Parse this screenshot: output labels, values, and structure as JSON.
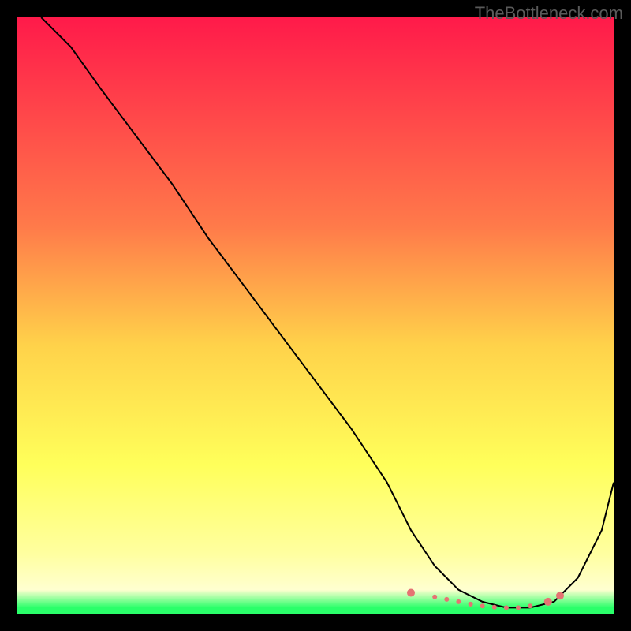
{
  "watermark": "TheBottleneck.com",
  "chart_data": {
    "type": "line",
    "title": "",
    "xlabel": "",
    "ylabel": "",
    "xlim": [
      0,
      100
    ],
    "ylim": [
      0,
      100
    ],
    "gradient_stops": [
      {
        "offset": 0,
        "color": "#ff1a4a"
      },
      {
        "offset": 35,
        "color": "#ff7a4a"
      },
      {
        "offset": 55,
        "color": "#ffd24a"
      },
      {
        "offset": 75,
        "color": "#ffff5a"
      },
      {
        "offset": 90,
        "color": "#ffffa0"
      },
      {
        "offset": 96,
        "color": "#ffffd0"
      },
      {
        "offset": 99,
        "color": "#2aff6a"
      }
    ],
    "series": [
      {
        "name": "curve",
        "color": "#000000",
        "x": [
          4,
          9,
          14,
          20,
          26,
          32,
          38,
          44,
          50,
          56,
          62,
          66,
          70,
          74,
          78,
          82,
          86,
          90,
          94,
          98,
          100
        ],
        "values": [
          100,
          95,
          88,
          80,
          72,
          63,
          55,
          47,
          39,
          31,
          22,
          14,
          8,
          4,
          2,
          1,
          1,
          2,
          6,
          14,
          22
        ]
      }
    ],
    "markers": {
      "color": "#e57373",
      "radius_small": 3,
      "radius_large": 5,
      "points": [
        {
          "x": 66,
          "y": 3.5,
          "r": "large"
        },
        {
          "x": 70,
          "y": 2.8,
          "r": "small"
        },
        {
          "x": 72,
          "y": 2.4,
          "r": "small"
        },
        {
          "x": 74,
          "y": 2.0,
          "r": "small"
        },
        {
          "x": 76,
          "y": 1.6,
          "r": "small"
        },
        {
          "x": 78,
          "y": 1.3,
          "r": "small"
        },
        {
          "x": 80,
          "y": 1.1,
          "r": "small"
        },
        {
          "x": 82,
          "y": 1.0,
          "r": "small"
        },
        {
          "x": 84,
          "y": 1.0,
          "r": "small"
        },
        {
          "x": 86,
          "y": 1.3,
          "r": "small"
        },
        {
          "x": 89,
          "y": 2.0,
          "r": "large"
        },
        {
          "x": 91,
          "y": 3.0,
          "r": "large"
        }
      ]
    }
  }
}
